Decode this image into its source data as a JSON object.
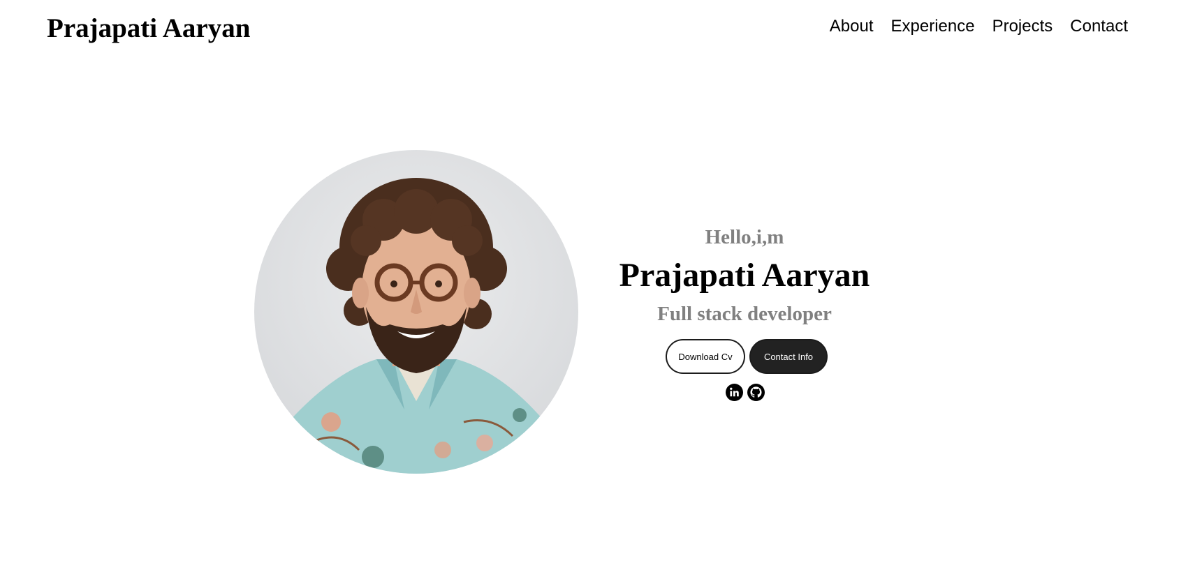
{
  "header": {
    "logo_text": "Prajapati Aaryan",
    "nav": [
      {
        "label": "About"
      },
      {
        "label": "Experience"
      },
      {
        "label": "Projects"
      },
      {
        "label": "Contact"
      }
    ]
  },
  "hero": {
    "greeting": "Hello,i,m",
    "name": "Prajapati Aaryan",
    "role": "Full stack developer",
    "download_cv_label": "Download Cv",
    "contact_info_label": "Contact Info",
    "profile_photo_alt": "Profile picture",
    "socials": [
      {
        "icon": "linkedin-icon"
      },
      {
        "icon": "github-icon"
      }
    ]
  },
  "colors": {
    "text_primary": "#000000",
    "text_secondary": "#808080",
    "button_dark": "#222222",
    "background": "#ffffff"
  }
}
